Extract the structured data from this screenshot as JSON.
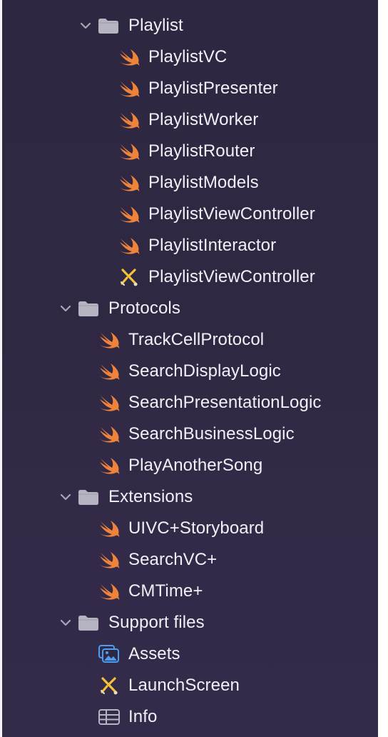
{
  "tree": {
    "groups": [
      {
        "name": "Playlist",
        "items": [
          {
            "label": "PlaylistVC",
            "icon": "swift-icon"
          },
          {
            "label": "PlaylistPresenter",
            "icon": "swift-icon"
          },
          {
            "label": "PlaylistWorker",
            "icon": "swift-icon"
          },
          {
            "label": "PlaylistRouter",
            "icon": "swift-icon"
          },
          {
            "label": "PlaylistModels",
            "icon": "swift-icon"
          },
          {
            "label": "PlaylistViewController",
            "icon": "swift-icon"
          },
          {
            "label": "PlaylistInteractor",
            "icon": "swift-icon"
          },
          {
            "label": "PlaylistViewController",
            "icon": "xib-icon"
          }
        ]
      },
      {
        "name": "Protocols",
        "items": [
          {
            "label": "TrackCellProtocol",
            "icon": "swift-icon"
          },
          {
            "label": "SearchDisplayLogic",
            "icon": "swift-icon"
          },
          {
            "label": "SearchPresentationLogic",
            "icon": "swift-icon"
          },
          {
            "label": "SearchBusinessLogic",
            "icon": "swift-icon"
          },
          {
            "label": "PlayAnotherSong",
            "icon": "swift-icon"
          }
        ]
      },
      {
        "name": "Extensions",
        "items": [
          {
            "label": "UIVC+Storyboard",
            "icon": "swift-icon"
          },
          {
            "label": "SearchVC+",
            "icon": "swift-icon"
          },
          {
            "label": "CMTime+",
            "icon": "swift-icon"
          }
        ]
      },
      {
        "name": "Support files",
        "items": [
          {
            "label": "Assets",
            "icon": "asset-catalog-icon"
          },
          {
            "label": "LaunchScreen",
            "icon": "xib-icon"
          },
          {
            "label": "Info",
            "icon": "plist-icon"
          }
        ]
      }
    ]
  },
  "colors": {
    "background": "#2f2842",
    "text": "#f2f0f6",
    "folder": "#b7b4c2",
    "chevron": "#a9a5b5",
    "swift": "#f0833a",
    "asset": "#4c9cf0",
    "xib": "#f3c13a"
  }
}
